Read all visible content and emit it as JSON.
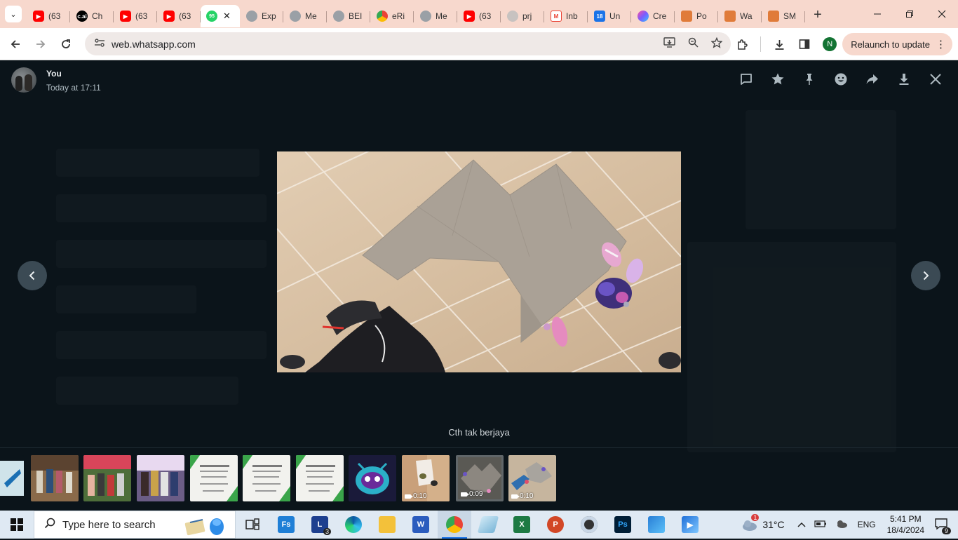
{
  "browser": {
    "tabs": [
      {
        "favicon": "youtube-icon",
        "label": "(63"
      },
      {
        "favicon": "character-ai-icon",
        "label": "Ch"
      },
      {
        "favicon": "youtube-icon",
        "label": "(63"
      },
      {
        "favicon": "youtube-icon",
        "label": "(63"
      },
      {
        "favicon": "whatsapp-icon",
        "label": "95",
        "active": true
      },
      {
        "favicon": "globe-icon",
        "label": "Exp"
      },
      {
        "favicon": "globe-icon",
        "label": "Me"
      },
      {
        "favicon": "globe-icon",
        "label": "BEI"
      },
      {
        "favicon": "chrome-icon",
        "label": "eRi"
      },
      {
        "favicon": "globe-icon",
        "label": "Me"
      },
      {
        "favicon": "youtube-icon",
        "label": "(63"
      },
      {
        "favicon": "loading-icon",
        "label": "prj"
      },
      {
        "favicon": "gmail-icon",
        "label": "Inb"
      },
      {
        "favicon": "calendar-icon",
        "label": "Un"
      },
      {
        "favicon": "color-icon",
        "label": "Cre"
      },
      {
        "favicon": "puzzle-icon",
        "label": "Po"
      },
      {
        "favicon": "puzzle-icon",
        "label": "Wa"
      },
      {
        "favicon": "puzzle-icon",
        "label": "SM"
      }
    ],
    "active_badge": "95",
    "url": "web.whatsapp.com",
    "profile_initial": "N",
    "relaunch_label": "Relaunch to update"
  },
  "viewer": {
    "sender": "You",
    "timestamp": "Today at 17:11",
    "caption": "Cth tak berjaya",
    "header_icons": [
      "message-icon",
      "star-icon",
      "pin-icon",
      "emoji-icon",
      "forward-icon",
      "download-icon",
      "close-icon"
    ],
    "thumbnails": [
      {
        "kind": "image",
        "theme": "blue-partial"
      },
      {
        "kind": "image",
        "theme": "people-outdoor"
      },
      {
        "kind": "image",
        "theme": "people-market"
      },
      {
        "kind": "image",
        "theme": "people-indoor"
      },
      {
        "kind": "image",
        "theme": "certificate"
      },
      {
        "kind": "image",
        "theme": "certificate"
      },
      {
        "kind": "image",
        "theme": "certificate"
      },
      {
        "kind": "image",
        "theme": "robot-mask"
      },
      {
        "kind": "video",
        "theme": "floor-tiles",
        "duration": "0:10"
      },
      {
        "kind": "video",
        "theme": "floor-tiles-selected",
        "duration": "0:09",
        "selected": true
      },
      {
        "kind": "video",
        "theme": "floor-tiles-blue",
        "duration": "0:10"
      }
    ]
  },
  "taskbar": {
    "search_placeholder": "Type here to search",
    "apps": [
      "task-view-icon",
      "fs-app-icon",
      "l-app-icon",
      "edge-icon",
      "file-explorer-icon",
      "word-icon",
      "chrome-icon",
      "notes-icon",
      "excel-icon",
      "powerpoint-icon",
      "obs-icon",
      "photoshop-icon",
      "photos-icon",
      "video-editor-icon"
    ],
    "l_app_badge": "3",
    "weather_badge": "1",
    "temperature": "31°C",
    "language": "ENG",
    "time": "5:41 PM",
    "date": "18/4/2024",
    "notification_count": "9",
    "colors": {
      "accent": "#53bdeb",
      "viewer_bg": "#0b141a",
      "tab_strip": "#f7d8cd"
    }
  }
}
